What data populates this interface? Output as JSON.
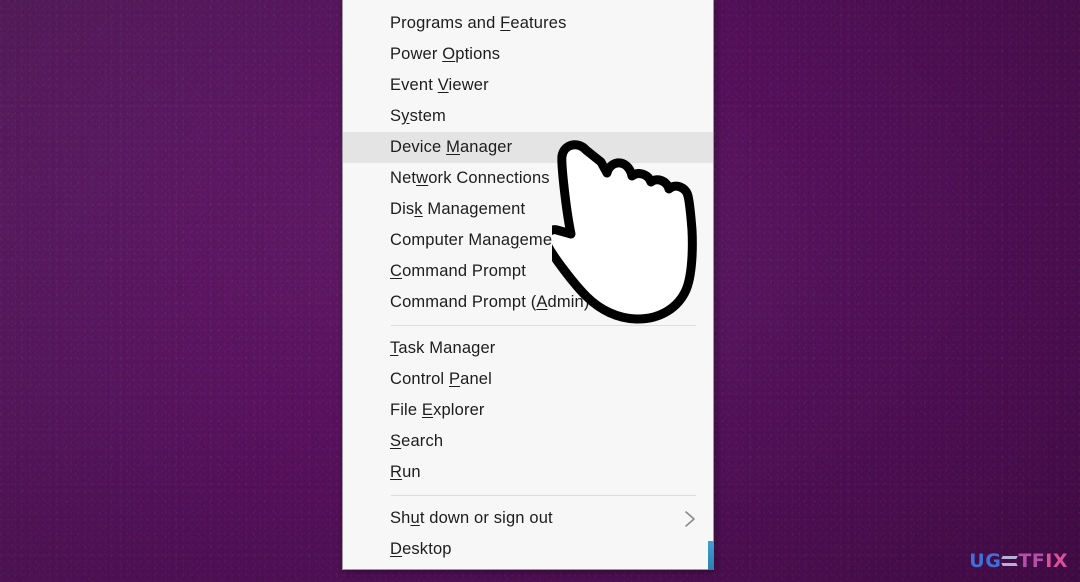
{
  "desktop": {
    "background_color": "#5b1463",
    "description": "textured purple desktop wallpaper"
  },
  "winx_menu": {
    "name": "Win+X Power User Menu",
    "background_color": "#f7f7f7",
    "highlight_color": "#e4e4e4",
    "border_color": "#9a9a9a",
    "groups": [
      {
        "id": "group-1",
        "items": [
          {
            "label": "Programs and Features",
            "accel": "F",
            "pre": "Programs and ",
            "post": "eatures",
            "highlighted": false,
            "submenu": false
          },
          {
            "label": "Power Options",
            "accel": "O",
            "pre": "Power ",
            "post": "ptions",
            "highlighted": false,
            "submenu": false
          },
          {
            "label": "Event Viewer",
            "accel": "V",
            "pre": "Event ",
            "post": "iewer",
            "highlighted": false,
            "submenu": false
          },
          {
            "label": "System",
            "accel": "y",
            "pre": "S",
            "post": "stem",
            "highlighted": false,
            "submenu": false
          },
          {
            "label": "Device Manager",
            "accel": "M",
            "pre": "Device ",
            "post": "anager",
            "highlighted": true,
            "submenu": false
          },
          {
            "label": "Network Connections",
            "accel": "w",
            "pre": "Net",
            "post": "ork Connections",
            "highlighted": false,
            "submenu": false
          },
          {
            "label": "Disk Management",
            "accel": "k",
            "pre": "Dis",
            "post": " Management",
            "highlighted": false,
            "submenu": false
          },
          {
            "label": "Computer Management",
            "accel": "g",
            "pre": "Computer Mana",
            "post": "ement",
            "highlighted": false,
            "submenu": false
          },
          {
            "label": "Command Prompt",
            "accel": "C",
            "pre": "",
            "post": "ommand Prompt",
            "highlighted": false,
            "submenu": false
          },
          {
            "label": "Command Prompt (Admin)",
            "accel": "A",
            "pre": "Command Prompt (",
            "post": "dmin)",
            "highlighted": false,
            "submenu": false
          }
        ]
      },
      {
        "id": "group-2",
        "items": [
          {
            "label": "Task Manager",
            "accel": "T",
            "pre": "",
            "post": "ask Manager",
            "highlighted": false,
            "submenu": false
          },
          {
            "label": "Control Panel",
            "accel": "P",
            "pre": "Control ",
            "post": "anel",
            "highlighted": false,
            "submenu": false
          },
          {
            "label": "File Explorer",
            "accel": "E",
            "pre": "File ",
            "post": "xplorer",
            "highlighted": false,
            "submenu": false
          },
          {
            "label": "Search",
            "accel": "S",
            "pre": "",
            "post": "earch",
            "highlighted": false,
            "submenu": false
          },
          {
            "label": "Run",
            "accel": "R",
            "pre": "",
            "post": "un",
            "highlighted": false,
            "submenu": false
          }
        ]
      },
      {
        "id": "group-3",
        "items": [
          {
            "label": "Shut down or sign out",
            "accel": "u",
            "pre": "Sh",
            "post": "t down or sign out",
            "highlighted": false,
            "submenu": true
          },
          {
            "label": "Desktop",
            "accel": "D",
            "pre": "",
            "post": "esktop",
            "highlighted": false,
            "submenu": false
          }
        ]
      }
    ]
  },
  "cursor": {
    "type": "pointing-hand",
    "fill": "#ffffff",
    "outline": "#000000",
    "pointing_at": "Device Manager"
  },
  "watermark": {
    "part_a": "UG",
    "glyph": "E",
    "part_b": "TF",
    "part_c": "IX",
    "full_text": "UGETFIX",
    "color_a": "#3f6fd8",
    "color_b": "#b34fa8",
    "color_c": "#d8519a"
  },
  "taskbar_accent": {
    "color": "#3f9fd4"
  }
}
